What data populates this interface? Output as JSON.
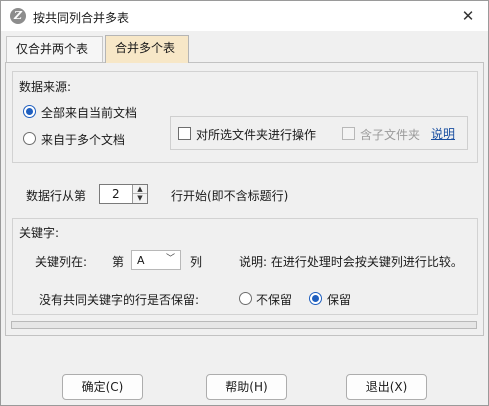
{
  "window": {
    "title": "按共同列合并多表",
    "icon": "z-logo-icon",
    "close_glyph": "✕"
  },
  "tabs": [
    {
      "label": "仅合并两个表",
      "active": false
    },
    {
      "label": "合并多个表",
      "active": true
    }
  ],
  "data_source": {
    "label": "数据来源:",
    "options": [
      {
        "label": "全部来自当前文档",
        "selected": true
      },
      {
        "label": "来自于多个文档",
        "selected": false
      }
    ],
    "folder_checkbox": {
      "label": "对所选文件夹进行操作",
      "checked": false
    },
    "subfolder_checkbox": {
      "label": "含子文件夹",
      "checked": false,
      "disabled": true
    },
    "help_link": "说明"
  },
  "data_row": {
    "prefix": "数据行从第",
    "value": "2",
    "suffix": "行开始(即不含标题行)",
    "spin_up": "▲",
    "spin_down": "▼"
  },
  "keyword": {
    "label": "关键字:",
    "key_col_label": "关键列在:",
    "col_prefix": "第",
    "col_value": "A",
    "col_suffix": "列",
    "dropdown_glyph": "﹀",
    "note": "说明: 在进行处理时会按关键列进行比较。",
    "keep_question": "没有共同关键字的行是否保留:",
    "keep_options": [
      {
        "label": "不保留",
        "selected": false
      },
      {
        "label": "保留",
        "selected": true
      }
    ]
  },
  "progress": {
    "value": 0
  },
  "buttons": {
    "ok": "确定(C)",
    "help": "帮助(H)",
    "exit": "退出(X)"
  }
}
